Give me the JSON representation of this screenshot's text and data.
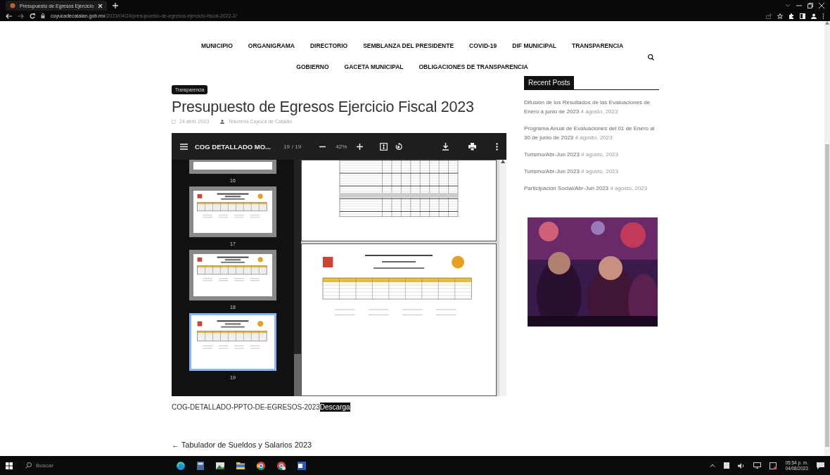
{
  "browser": {
    "tab_title": "Presupuesto de Egresos Ejercicio",
    "url_host": "coyucadecatalan.gob.mx",
    "url_path": "/2023/04/24/presupuesto-de-egresos-ejercicio-fiscal-2022-2/"
  },
  "nav": {
    "row_1": [
      "MUNICIPIO",
      "ORGANIGRAMA",
      "DIRECTORIO",
      "SEMBLANZA DEL PRESIDENTE",
      "COVID-19",
      "DIF MUNICIPAL",
      "TRANSPARENCIA"
    ],
    "row_2": [
      "GOBIERNO",
      "GACETA MUNICIPAL",
      "OBLIGACIONES DE TRANSPARENCIA"
    ]
  },
  "post": {
    "category": "Transparencia",
    "title": "Presupuesto de Egresos Ejercicio Fiscal 2023",
    "date": "24 abril, 2023",
    "author": "Tesorería Coyuca de Catalán",
    "pdf_viewer": {
      "file_name": "COG DETALLADO MO...",
      "page": "19",
      "page_total": "/ 19",
      "zoom": "42%",
      "thumbnails": [
        {
          "label": "16",
          "selected": false
        },
        {
          "label": "17",
          "selected": false
        },
        {
          "label": "18",
          "selected": false
        },
        {
          "label": "19",
          "selected": true
        }
      ]
    },
    "caption": "COG-DETALLADO-PPTO-DE-EGRESOS-2023",
    "download_link": "Descarga",
    "prev_post": "← Tabulador de Sueldos y Salarios 2023"
  },
  "sidebar": {
    "heading": "Recent Posts",
    "posts": [
      {
        "title": "Difusión de los Resultados de las Evaluaciones de Enero a junio de 2023",
        "date": "4 agosto, 2023"
      },
      {
        "title": "Programa Anual de Evaluaciones del 01 de Enero al 30 de junio de 2023",
        "date": "4 agosto, 2023"
      },
      {
        "title": "Turismo/Abr-Jun 2023",
        "date": "4 agosto, 2023"
      },
      {
        "title": "Turismo/Abr-Jun 2023",
        "date": "4 agosto, 2023"
      },
      {
        "title": "Participación Social/Abr-Jun 2023",
        "date": "4 agosto, 2023"
      }
    ]
  },
  "taskbar": {
    "search_placeholder": "Buscar",
    "time": "05:54 p. m.",
    "date": "04/08/2023"
  }
}
